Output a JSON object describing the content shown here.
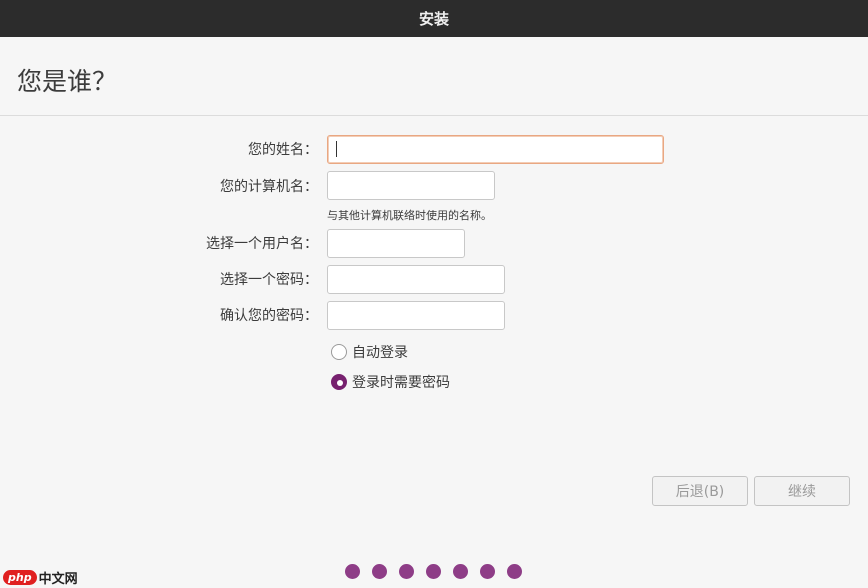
{
  "window": {
    "title": "安装"
  },
  "page": {
    "heading": "您是谁？"
  },
  "form": {
    "name_label": "您的姓名：",
    "name_value": "",
    "computer_label": "您的计算机名：",
    "computer_value": "",
    "computer_hint": "与其他计算机联络时使用的名称。",
    "username_label": "选择一个用户名：",
    "username_value": "",
    "password_label": "选择一个密码：",
    "password_value": "",
    "confirm_label": "确认您的密码：",
    "confirm_value": ""
  },
  "login_options": {
    "auto_login": {
      "label": "自动登录",
      "selected": false
    },
    "require_password": {
      "label": "登录时需要密码",
      "selected": true
    }
  },
  "buttons": {
    "back": "后退(B)",
    "continue": "继续"
  },
  "progress": {
    "total_steps": 7
  },
  "watermark": {
    "logo": "php",
    "text": "中文网"
  },
  "colors": {
    "titlebar": "#2c2c2c",
    "accent": "#77216f",
    "progress_dot": "#8e3d87",
    "focus_border": "#e9a782"
  }
}
